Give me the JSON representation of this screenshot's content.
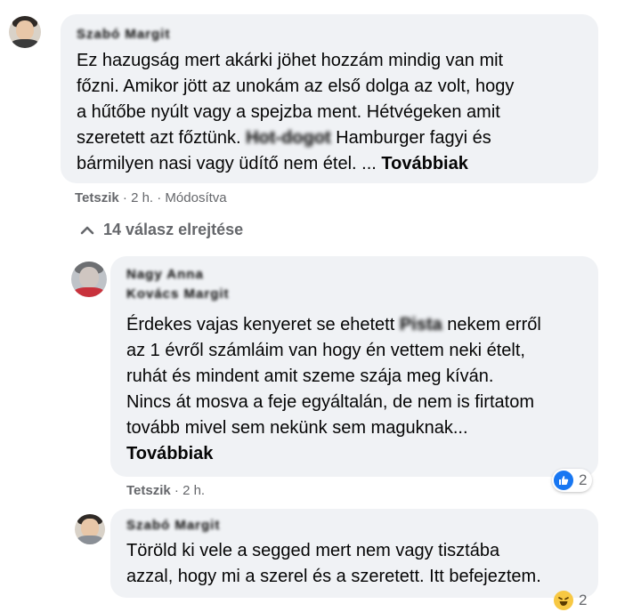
{
  "comments": [
    {
      "author": "Szabó Margit",
      "lines": [
        "Ez hazugság mert akárki jöhet hozzám mindig van mit",
        "főzni. Amikor jött az unokám az első dolga az volt, hogy",
        "a hűtőbe nyúlt vagy a spejzba ment. Hétvégeken amit"
      ],
      "line4_before": "szeretett azt főztünk. ",
      "line4_hidden": "Hot-dogot",
      "line4_after": " Hamburger fagyi és",
      "line5": "bármilyen nasi vagy üdítő nem étel. ... ",
      "more": "Továbbiak",
      "like": "Tetszik",
      "meta": " · 2 h. · Módosítva"
    },
    {
      "author_line1": "Nagy Anna",
      "author_line2": "Kovács Margit",
      "line1_before": "Érdekes vajas kenyeret se ehetett ",
      "line1_hidden": "Pista",
      "line1_after": " nekem erről",
      "lines": [
        "az 1 évről számláim van hogy én vettem neki ételt,",
        "ruhát és mindent amit szeme szája meg kíván.",
        "Nincs át mosva a feje egyáltalán, de nem is firtatom",
        "tovább mivel sem nekünk sem maguknak..."
      ],
      "more": "Továbbiak",
      "like": "Tetszik",
      "meta": " · 2 h.",
      "reaction_count": "2"
    },
    {
      "author": "Szabó Margit",
      "lines": [
        "Töröld ki vele a segged mert nem vagy tisztába",
        "azzal, hogy mi a szerel és a szeretett. Itt befejeztem."
      ],
      "reaction_count": "2"
    }
  ],
  "replies_toggle": "14 válasz elrejtése",
  "icons": {
    "toggle": "chevron-up-icon",
    "like": "like-reaction-icon",
    "haha": "haha-reaction-icon"
  },
  "colors": {
    "bubble": "#f0f2f5",
    "meta_gray": "#65676b",
    "like_blue": "#1877f2"
  }
}
